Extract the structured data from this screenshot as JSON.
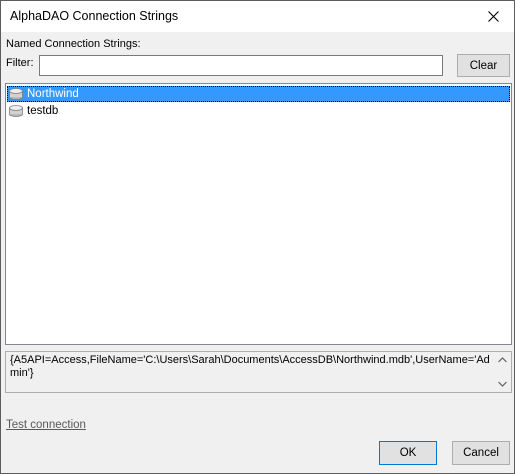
{
  "window": {
    "title": "AlphaDAO Connection Strings"
  },
  "labels": {
    "named_connections": "Named Connection Strings:",
    "filter": "Filter:"
  },
  "filter": {
    "value": "",
    "placeholder": ""
  },
  "buttons": {
    "clear": "Clear",
    "ok": "OK",
    "cancel": "Cancel"
  },
  "connections": {
    "items": [
      {
        "label": "Northwind",
        "selected": true,
        "icon": "database-icon"
      },
      {
        "label": "testdb",
        "selected": false,
        "icon": "database-icon"
      }
    ]
  },
  "connection_string": {
    "text": "{A5API=Access,FileName='C:\\Users\\Sarah\\Documents\\AccessDB\\Northwind.mdb',UserName='Admin'}"
  },
  "links": {
    "test_connection": "Test connection"
  },
  "colors": {
    "selection": "#3399ff",
    "accent_border": "#0078d7",
    "window_bg": "#f0f0f0"
  }
}
